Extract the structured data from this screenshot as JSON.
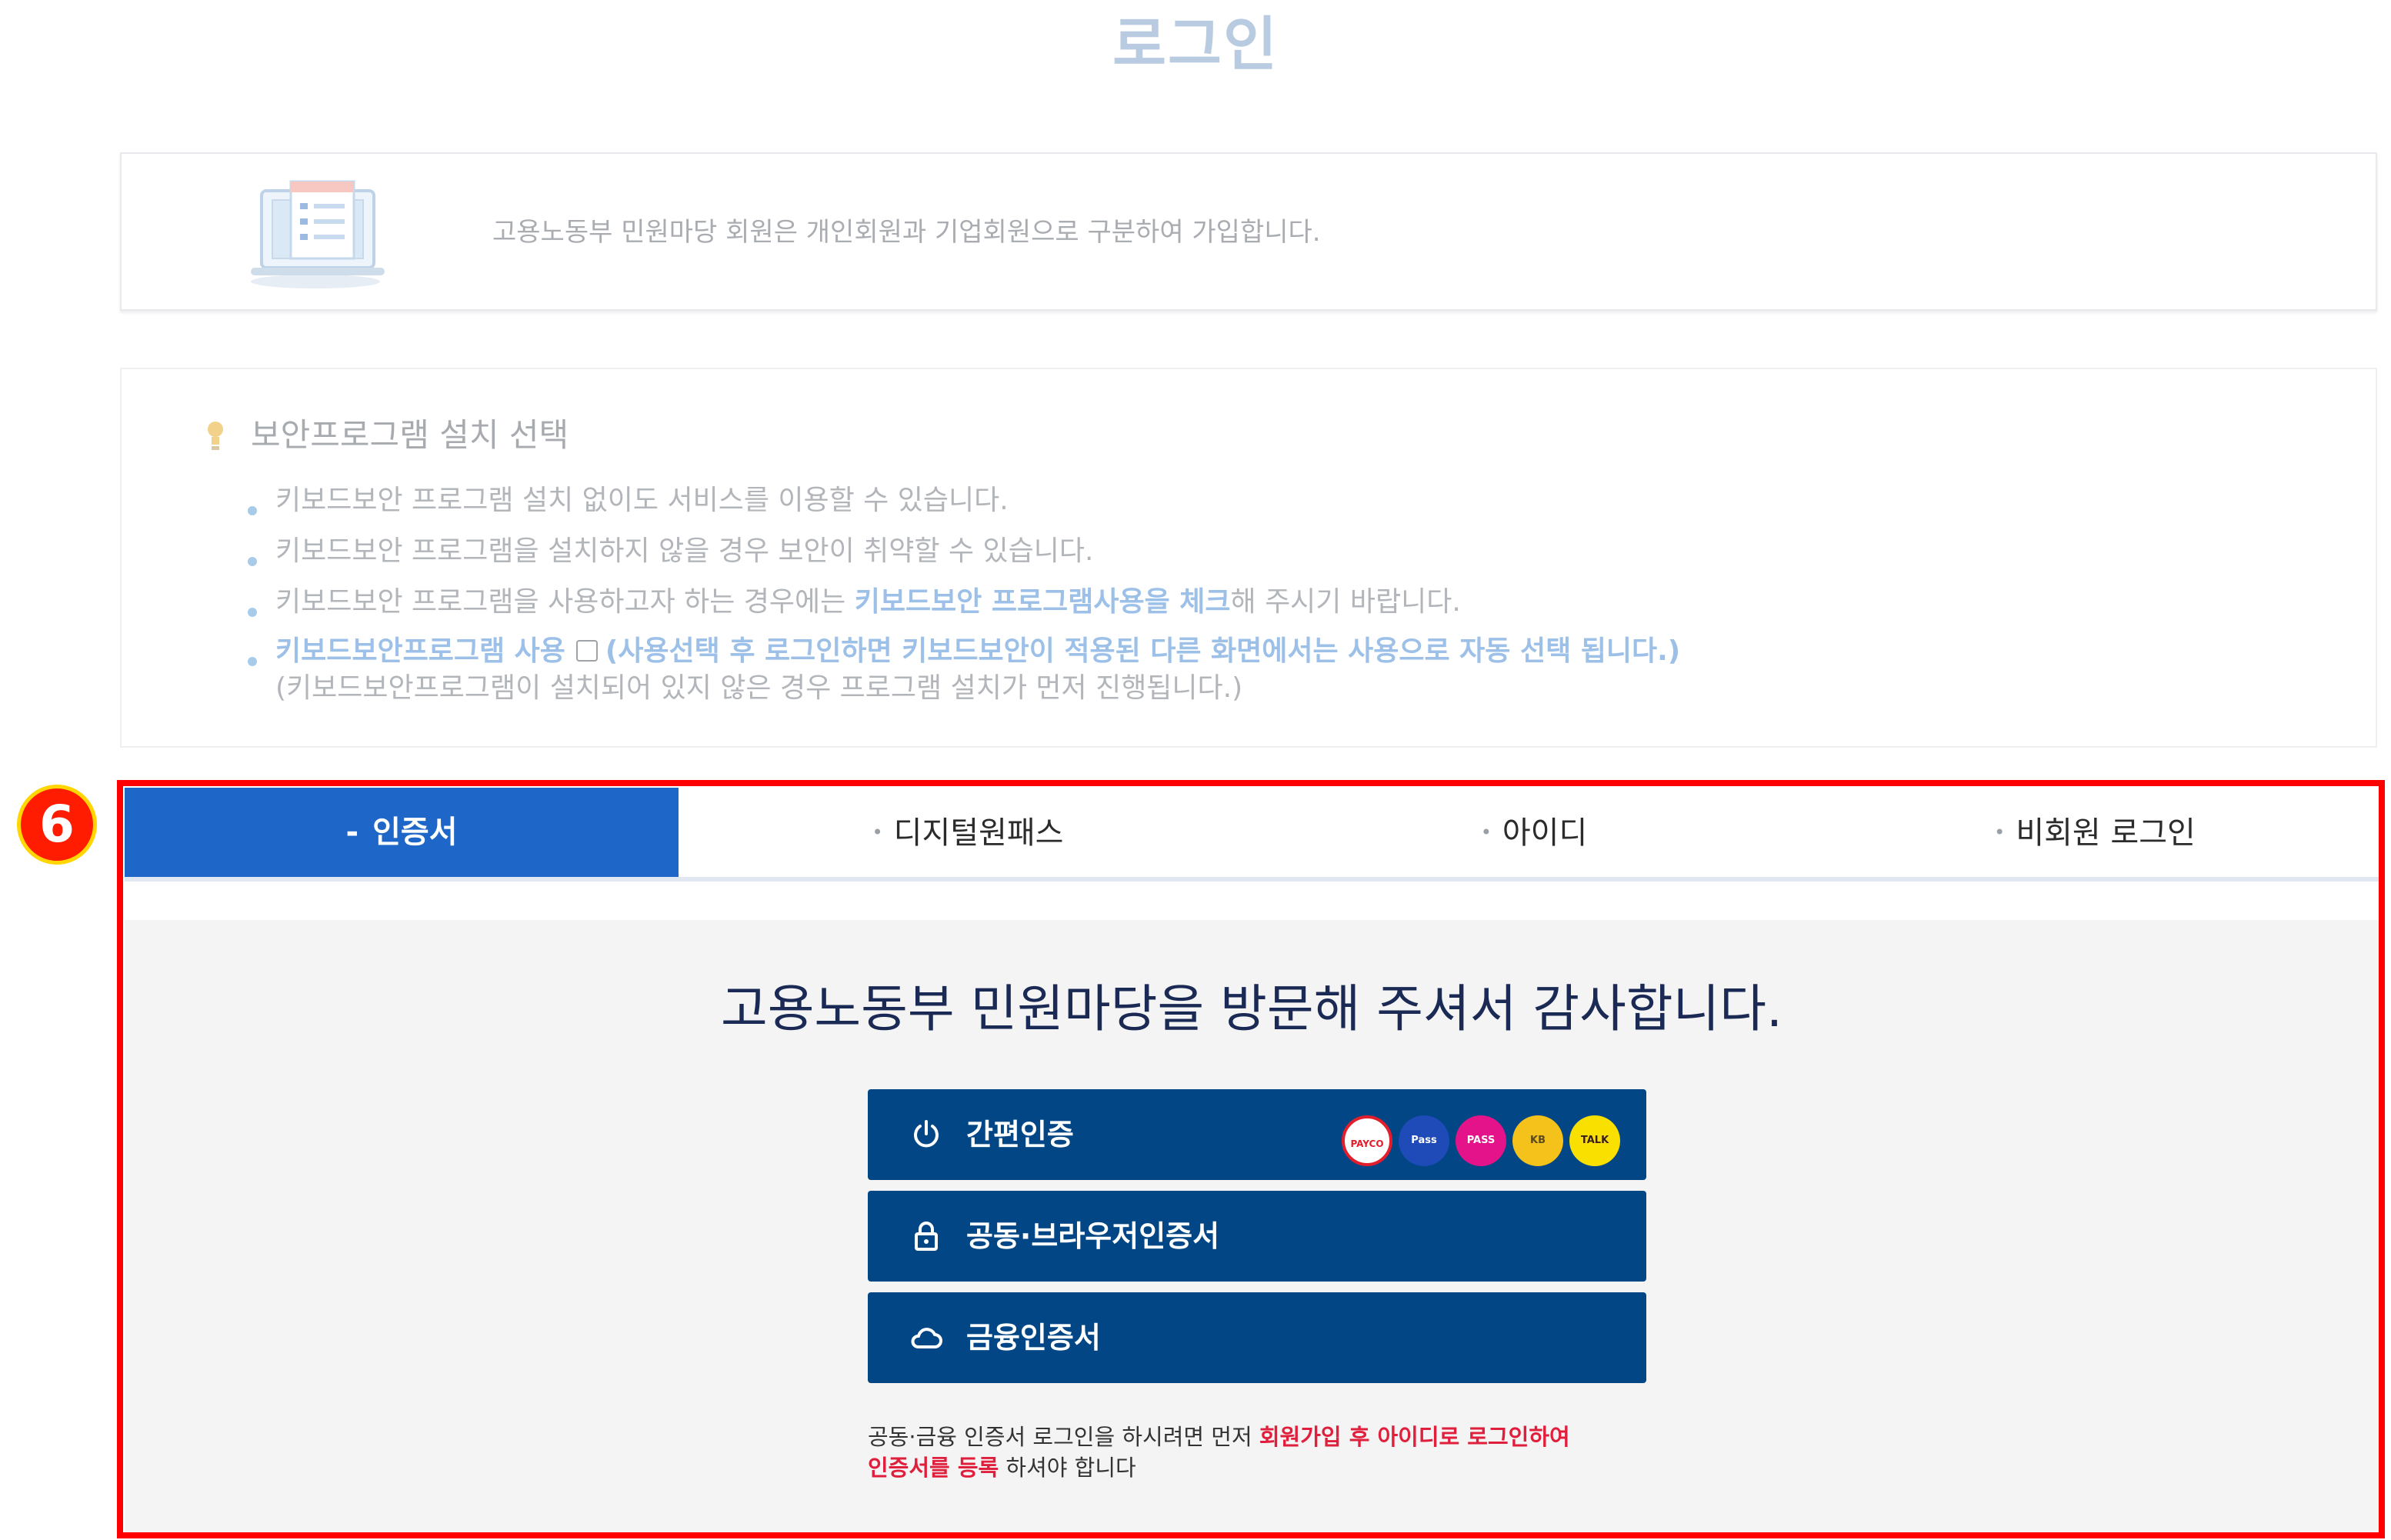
{
  "page": {
    "title": "로그인"
  },
  "info": {
    "icon": "laptop-list-icon",
    "text": "고용노동부 민원마당 회원은 개인회원과 기업회원으로 구분하여 가입합니다."
  },
  "security": {
    "icon": "lightbulb-icon",
    "heading": "보안프로그램 설치 선택",
    "items": [
      "키보드보안 프로그램 설치 없이도 서비스를 이용할 수 있습니다.",
      "키보드보안 프로그램을 설치하지 않을 경우 보안이 취약할 수 있습니다."
    ],
    "item3": {
      "before": "키보드보안 프로그램을 사용하고자 하는 경우에는 ",
      "highlight": "키보드보안 프로그램사용을 체크",
      "after": "해 주시기 바랍니다."
    },
    "item4": {
      "checkbox_label": "키보드보안프로그램 사용",
      "checked": false,
      "note": "(사용선택 후 로그인하면 키보드보안이 적용된 다른 화면에서는 사용으로 자동 선택 됩니다.)",
      "subnote": "(키보드보안프로그램이 설치되어 있지 않은 경우 프로그램 설치가 먼저 진행됩니다.)"
    }
  },
  "annotation": {
    "step_number": "6",
    "frame_color": "#ff0000"
  },
  "tabs": [
    {
      "label": "인증서",
      "active": true
    },
    {
      "label": "디지털원패스",
      "active": false
    },
    {
      "label": "아이디",
      "active": false
    },
    {
      "label": "비회원 로그인",
      "active": false
    }
  ],
  "panel": {
    "title": "고용노동부 민원마당을 방문해 주셔서 감사합니다.",
    "buttons": [
      {
        "label": "간편인증",
        "icon": "power-icon"
      },
      {
        "label": "공동·브라우저인증서",
        "icon": "lock-icon"
      },
      {
        "label": "금융인증서",
        "icon": "cloud-icon"
      }
    ],
    "providers": [
      {
        "name": "PAYCO",
        "color": "#ffffff"
      },
      {
        "name": "Pass",
        "color": "#1e4bb8"
      },
      {
        "name": "PASS",
        "color": "#e4138a"
      },
      {
        "name": "KB",
        "color": "#f4c21a"
      },
      {
        "name": "TALK",
        "color": "#f9e000"
      }
    ],
    "note": {
      "part1": "공동·금융 인증서 로그인을 하시려면 먼저 ",
      "red1": "회원가입 후 아이디로 로그인하여",
      "red2": "인증서를 등록",
      "part2": " 하셔야 합니다"
    }
  },
  "colors": {
    "tab_active": "#1e66c7",
    "button": "#024685",
    "panel_bg": "#f4f4f4",
    "title": "#b8cbe0",
    "note_red": "#e01f3d"
  }
}
